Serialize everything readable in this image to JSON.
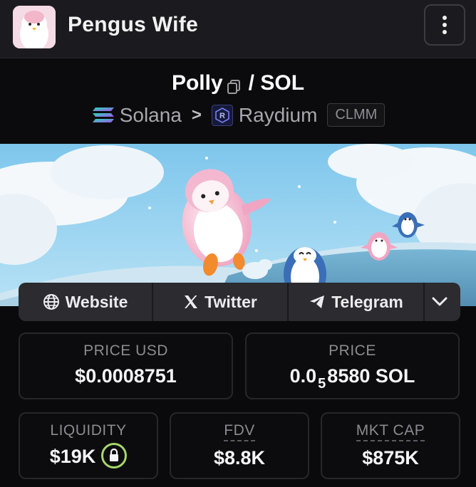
{
  "header": {
    "title": "Pengus Wife",
    "avatar_icon": "penguin-avatar-icon",
    "menu_icon": "more-vertical-icon"
  },
  "pair": {
    "base": "Polly",
    "separator": "/",
    "quote": "SOL",
    "copy_icon": "copy-icon"
  },
  "chain": {
    "network": "Solana",
    "arrow": ">",
    "dex": "Raydium",
    "pool_type": "CLMM"
  },
  "links": {
    "website": "Website",
    "twitter": "Twitter",
    "telegram": "Telegram",
    "more_icon": "chevron-down-icon"
  },
  "stats": {
    "price_usd_label": "PRICE USD",
    "price_usd_value": "$0.0008751",
    "price_label": "PRICE",
    "price_prefix": "0.0",
    "price_zero_count": "5",
    "price_suffix": "8580 SOL",
    "liquidity_label": "LIQUIDITY",
    "liquidity_value": "$19K",
    "fdv_label": "FDV",
    "fdv_value": "$8.8K",
    "mktcap_label": "MKT CAP",
    "mktcap_value": "$875K"
  },
  "colors": {
    "accent_lock": "#a6d66b",
    "background": "#0a0a0c",
    "header_bg": "#1b1b1f"
  }
}
